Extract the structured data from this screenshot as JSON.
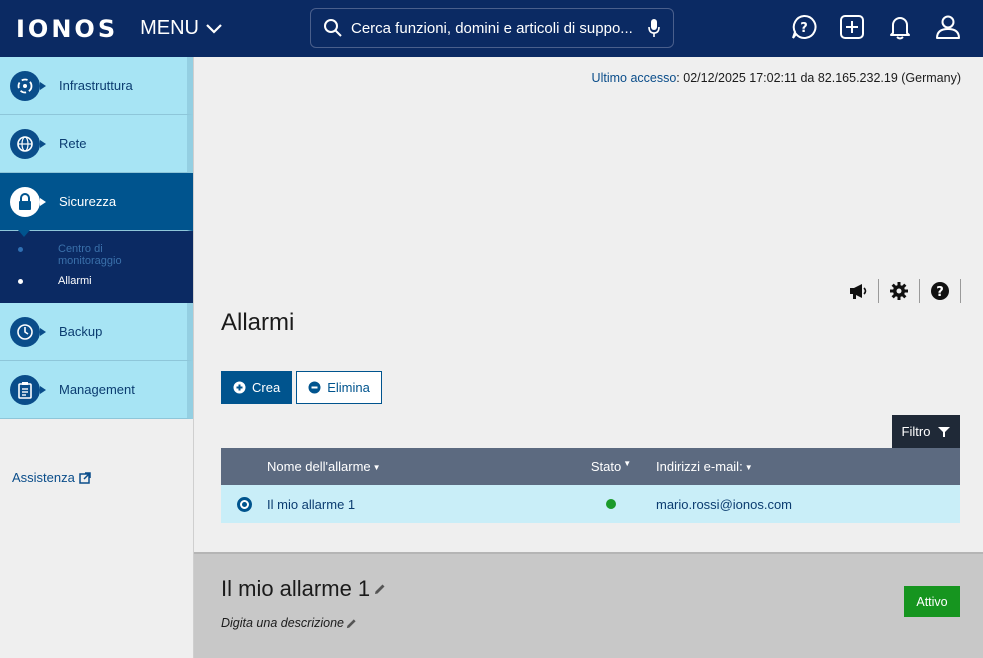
{
  "header": {
    "logo": "IONOS",
    "menu_label": "MENU",
    "search_placeholder": "Cerca funzioni, domini e articoli di suppo..."
  },
  "sidebar": {
    "items": [
      {
        "label": "Infrastruttura"
      },
      {
        "label": "Rete"
      },
      {
        "label": "Sicurezza"
      },
      {
        "label": "Backup"
      },
      {
        "label": "Management"
      }
    ],
    "subitems": [
      {
        "label": "Centro di monitoraggio"
      },
      {
        "label": "Allarmi"
      }
    ],
    "help_link": "Assistenza"
  },
  "last_access": {
    "label": "Ultimo accesso",
    "value": ": 02/12/2025 17:02:11 da 82.165.232.19 (Germany)"
  },
  "page": {
    "title": "Allarmi",
    "create_label": "Crea",
    "delete_label": "Elimina",
    "filter_label": "Filtro"
  },
  "table": {
    "headers": [
      "Nome dell'allarme",
      "Stato",
      "Indirizzi e-mail:"
    ],
    "rows": [
      {
        "name": "Il mio allarme 1",
        "status": "active",
        "email": "mario.rossi@ionos.com"
      }
    ]
  },
  "detail": {
    "title": "Il mio allarme 1",
    "description_placeholder": "Digita una descrizione",
    "status_badge": "Attivo"
  },
  "colors": {
    "topbar": "#0b2a63",
    "accent": "#00548e",
    "nav_bg": "#a7e4f4",
    "status_green": "#16951f"
  }
}
